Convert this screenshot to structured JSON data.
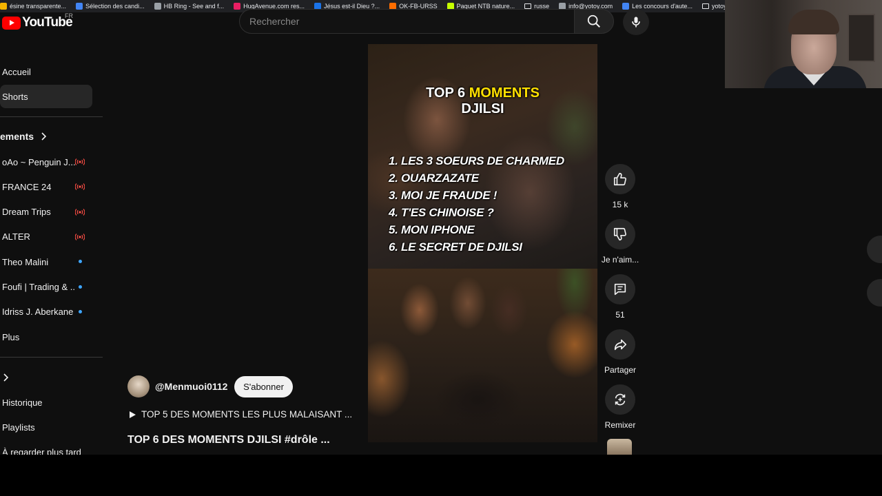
{
  "bookmarks": [
    {
      "label": "ésine transparente...",
      "color": "#f4b400"
    },
    {
      "label": "Sélection des candi...",
      "color": "#4285f4"
    },
    {
      "label": "HB Ring - See and f...",
      "color": "#9aa0a6"
    },
    {
      "label": "HugAvenue.com res...",
      "color": "#e91e63"
    },
    {
      "label": "Jésus est-il Dieu ?...",
      "color": "#1a73e8"
    },
    {
      "label": "OK-FB-URSS",
      "color": "#ff6d00"
    },
    {
      "label": "Paquet NTB nature...",
      "color": "#c6ff00"
    },
    {
      "label": "russe",
      "color": "folder"
    },
    {
      "label": "info@yotoy.com",
      "color": "#9aa0a6"
    },
    {
      "label": "Les concours d'aute...",
      "color": "#4285f4"
    },
    {
      "label": "yotoy",
      "color": "folder"
    }
  ],
  "header": {
    "logo_text": "YouTube",
    "country_code": "FR",
    "search_placeholder": "Rechercher"
  },
  "sidebar": {
    "home": "Accueil",
    "shorts": "Shorts",
    "subscriptions_title": "ements",
    "subscriptions": [
      {
        "label": "oAo ~ Penguin J...",
        "indicator": "live"
      },
      {
        "label": "FRANCE 24",
        "indicator": "live"
      },
      {
        "label": "Dream Trips",
        "indicator": "live"
      },
      {
        "label": "ALTER",
        "indicator": "live"
      },
      {
        "label": "Theo Malini",
        "indicator": "dot"
      },
      {
        "label": "Foufi | Trading & ...",
        "indicator": "dot"
      },
      {
        "label": "Idriss J. Aberkane",
        "indicator": "dot"
      },
      {
        "label": "Plus",
        "indicator": "none"
      }
    ],
    "you_items": [
      "Historique",
      "Playlists",
      "À regarder plus tard"
    ]
  },
  "video": {
    "title_part1": "TOP 6 ",
    "title_highlight": "MOMENTS",
    "title_line2": "DJILSI",
    "list": [
      "1.  LES 3 SOEURS DE CHARMED",
      "2.  OUARZAZATE",
      "3.  MOI JE FRAUDE !",
      "4.  T'ES CHINOISE ?",
      "5.  MON IPHONE",
      "6.  LE SECRET DE DJILSI"
    ],
    "highlight_color": "#ffe000"
  },
  "actions": {
    "like_count": "15 k",
    "dislike_label": "Je n'aim...",
    "comments_count": "51",
    "share_label": "Partager",
    "remix_label": "Remixer"
  },
  "channel": {
    "handle": "@Menmuoi0112",
    "subscribe_label": "S'abonner",
    "playlist_text": "TOP 5 DES MOMENTS LES PLUS MALAISANT ...",
    "video_title": "TOP 6 DES MOMENTS DJILSI  #drôle ..."
  }
}
